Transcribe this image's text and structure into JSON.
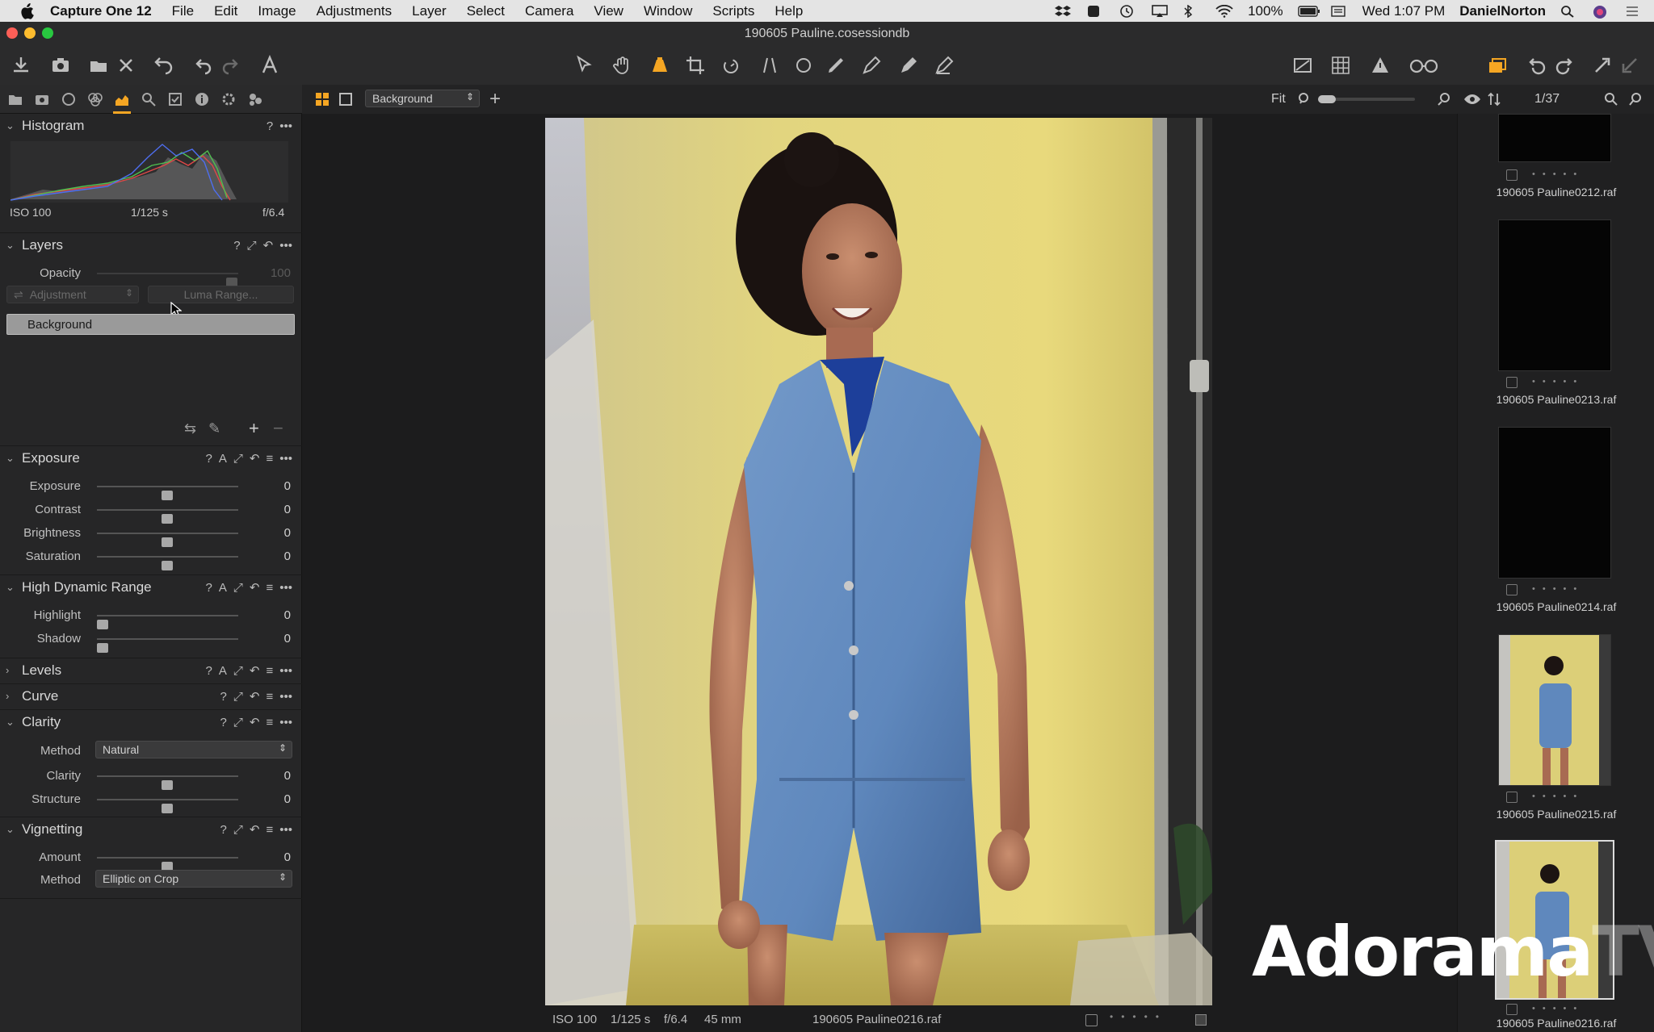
{
  "menubar": {
    "app_name": "Capture One 12",
    "items": [
      "File",
      "Edit",
      "Image",
      "Adjustments",
      "Layer",
      "Select",
      "Camera",
      "View",
      "Window",
      "Scripts",
      "Help"
    ],
    "battery": "100%",
    "clock": "Wed 1:07 PM",
    "user": "DanielNorton"
  },
  "window": {
    "title": "190605 Pauline.cosessiondb"
  },
  "viewerbar": {
    "layer_select": "Background",
    "fit_label": "Fit"
  },
  "browserbar": {
    "counter": "1/37"
  },
  "histogram": {
    "title": "Histogram",
    "iso": "ISO 100",
    "shutter": "1/125 s",
    "aperture": "f/6.4"
  },
  "layers": {
    "title": "Layers",
    "opacity_label": "Opacity",
    "opacity_value": "100",
    "adjustment_label": "Adjustment",
    "luma_label": "Luma Range...",
    "background_layer": "Background"
  },
  "exposure": {
    "title": "Exposure",
    "sliders": [
      {
        "label": "Exposure",
        "value": "0"
      },
      {
        "label": "Contrast",
        "value": "0"
      },
      {
        "label": "Brightness",
        "value": "0"
      },
      {
        "label": "Saturation",
        "value": "0"
      }
    ]
  },
  "hdr": {
    "title": "High Dynamic Range",
    "sliders": [
      {
        "label": "Highlight",
        "value": "0"
      },
      {
        "label": "Shadow",
        "value": "0"
      }
    ]
  },
  "levels": {
    "title": "Levels"
  },
  "curve": {
    "title": "Curve"
  },
  "clarity": {
    "title": "Clarity",
    "method_label": "Method",
    "method_value": "Natural",
    "sliders": [
      {
        "label": "Clarity",
        "value": "0"
      },
      {
        "label": "Structure",
        "value": "0"
      }
    ]
  },
  "vignetting": {
    "title": "Vignetting",
    "amount_label": "Amount",
    "amount_value": "0",
    "method_label": "Method",
    "method_value": "Elliptic on Crop"
  },
  "viewer_status": {
    "iso": "ISO 100",
    "shutter": "1/125 s",
    "aperture": "f/6.4",
    "focal": "45 mm",
    "filename": "190605 Pauline0216.raf"
  },
  "browser": {
    "thumbs": [
      {
        "name": "190605 Pauline0212.raf"
      },
      {
        "name": "190605 Pauline0213.raf"
      },
      {
        "name": "190605 Pauline0214.raf"
      },
      {
        "name": "190605 Pauline0215.raf"
      },
      {
        "name": "190605 Pauline0216.raf"
      }
    ]
  },
  "watermark": {
    "brand": "Adorama",
    "suffix": "TV"
  },
  "colors": {
    "accent": "#f5a623",
    "backdrop": "#e3d57a",
    "denim": "#5f88bd"
  }
}
